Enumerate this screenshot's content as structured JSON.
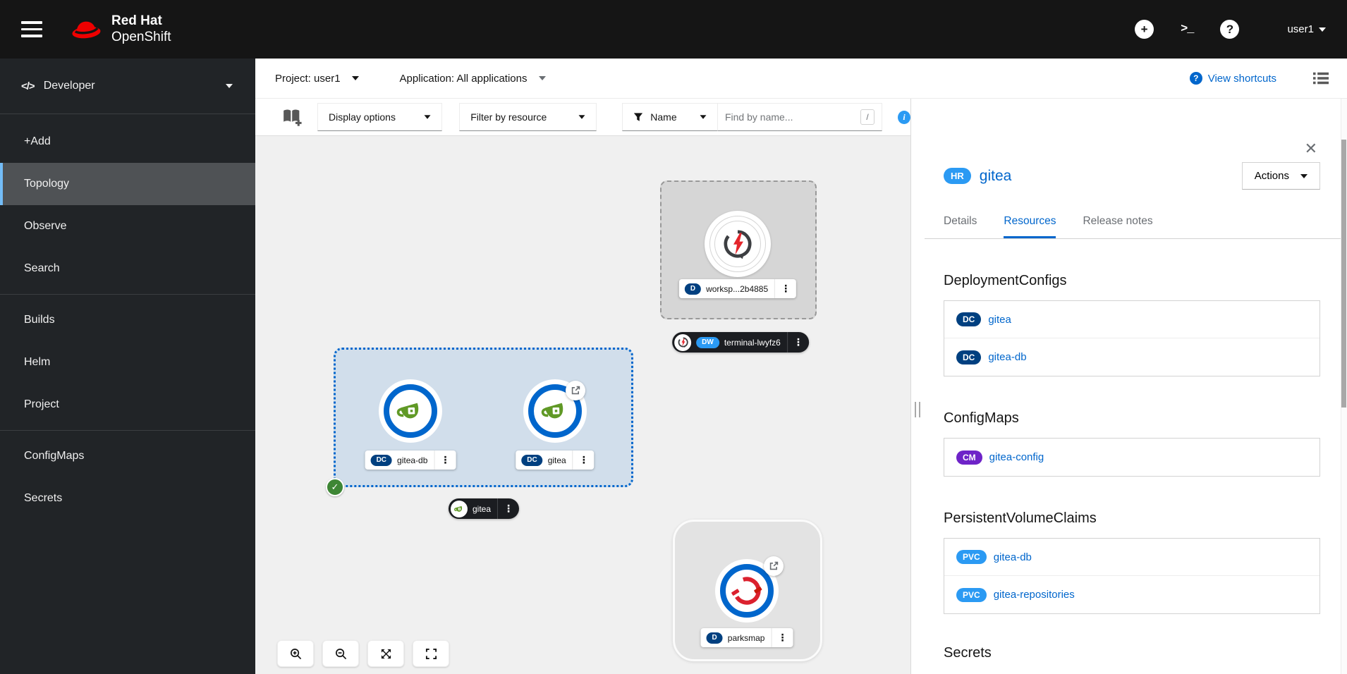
{
  "colors": {
    "accent": "#0066cc",
    "brand_red": "#ee0000",
    "success_green": "#3e8635",
    "badge_d": "#004080",
    "badge_dc": "#004080",
    "badge_dw": "#2b9af3",
    "badge_cm": "#6e23c8",
    "badge_pvc": "#2b9af3",
    "badge_hr": "#2b9af3",
    "sidebar_active_accent": "#73bcf7"
  },
  "masthead": {
    "brand_top": "Red Hat",
    "brand_bottom": "OpenShift",
    "user_menu": "user1"
  },
  "sidebar": {
    "perspective": "Developer",
    "items": [
      {
        "label": "+Add"
      },
      {
        "label": "Topology"
      },
      {
        "label": "Observe"
      },
      {
        "label": "Search"
      },
      {
        "label": "Builds"
      },
      {
        "label": "Helm"
      },
      {
        "label": "Project"
      },
      {
        "label": "ConfigMaps"
      },
      {
        "label": "Secrets"
      }
    ]
  },
  "context_bar": {
    "project": "Project: user1",
    "application": "Application: All applications",
    "view_shortcuts": "View shortcuts"
  },
  "topology_toolbar": {
    "display_options": "Display options",
    "filter_by_resource": "Filter by resource",
    "filter_mode": "Name",
    "find_placeholder": "Find by name...",
    "shortcut_hint": "/"
  },
  "canvas": {
    "workspace_node": {
      "badge": "D",
      "label": "worksp...2b4885"
    },
    "devworkspace_label": {
      "badge": "DW",
      "label": "terminal-lwyfz6"
    },
    "gitea_group": {
      "app_label": "gitea",
      "nodes": [
        {
          "badge": "DC",
          "label": "gitea-db"
        },
        {
          "badge": "DC",
          "label": "gitea"
        }
      ]
    },
    "parksmap_node": {
      "badge": "D",
      "label": "parksmap"
    }
  },
  "side_panel": {
    "badge": "HR",
    "title": "gitea",
    "actions": "Actions",
    "tabs": [
      {
        "label": "Details"
      },
      {
        "label": "Resources"
      },
      {
        "label": "Release notes"
      }
    ],
    "sections": [
      {
        "heading": "DeploymentConfigs",
        "items": [
          {
            "badge": "DC",
            "label": "gitea"
          },
          {
            "badge": "DC",
            "label": "gitea-db"
          }
        ]
      },
      {
        "heading": "ConfigMaps",
        "items": [
          {
            "badge": "CM",
            "label": "gitea-config"
          }
        ]
      },
      {
        "heading": "PersistentVolumeClaims",
        "items": [
          {
            "badge": "PVC",
            "label": "gitea-db"
          },
          {
            "badge": "PVC",
            "label": "gitea-repositories"
          }
        ]
      },
      {
        "heading": "Secrets",
        "items": []
      }
    ]
  }
}
